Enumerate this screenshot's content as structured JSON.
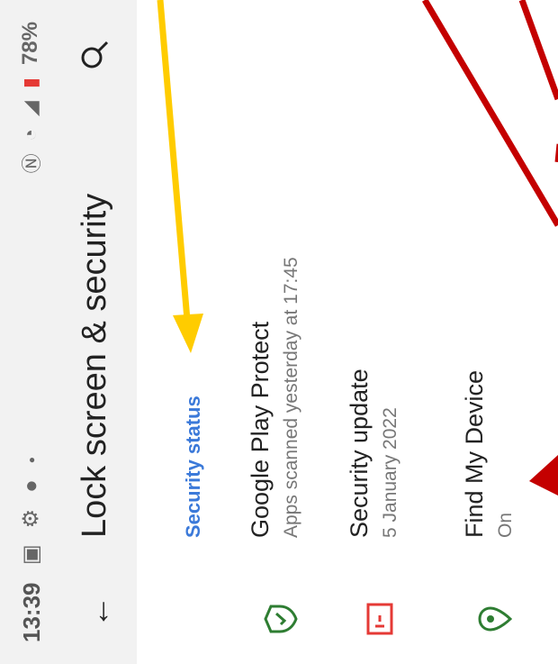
{
  "status_bar": {
    "time": "13:39",
    "battery_percent": "78%"
  },
  "app_bar": {
    "title": "Lock screen & security"
  },
  "section": {
    "title": "Security status"
  },
  "items": [
    {
      "title": "Google Play Protect",
      "subtitle": "Apps scanned yesterday at 17:45",
      "icon": "shield-check-icon",
      "color": "#2e7d32"
    },
    {
      "title": "Security update",
      "subtitle": "5 January 2022",
      "icon": "update-icon",
      "color": "#e53935"
    },
    {
      "title": "Find My Device",
      "subtitle": "On",
      "icon": "location-pin-icon",
      "color": "#2e7d32"
    }
  ],
  "colors": {
    "accent": "#3b79d9",
    "arrow_yellow": "#ffcc00",
    "arrow_red": "#c40000"
  }
}
